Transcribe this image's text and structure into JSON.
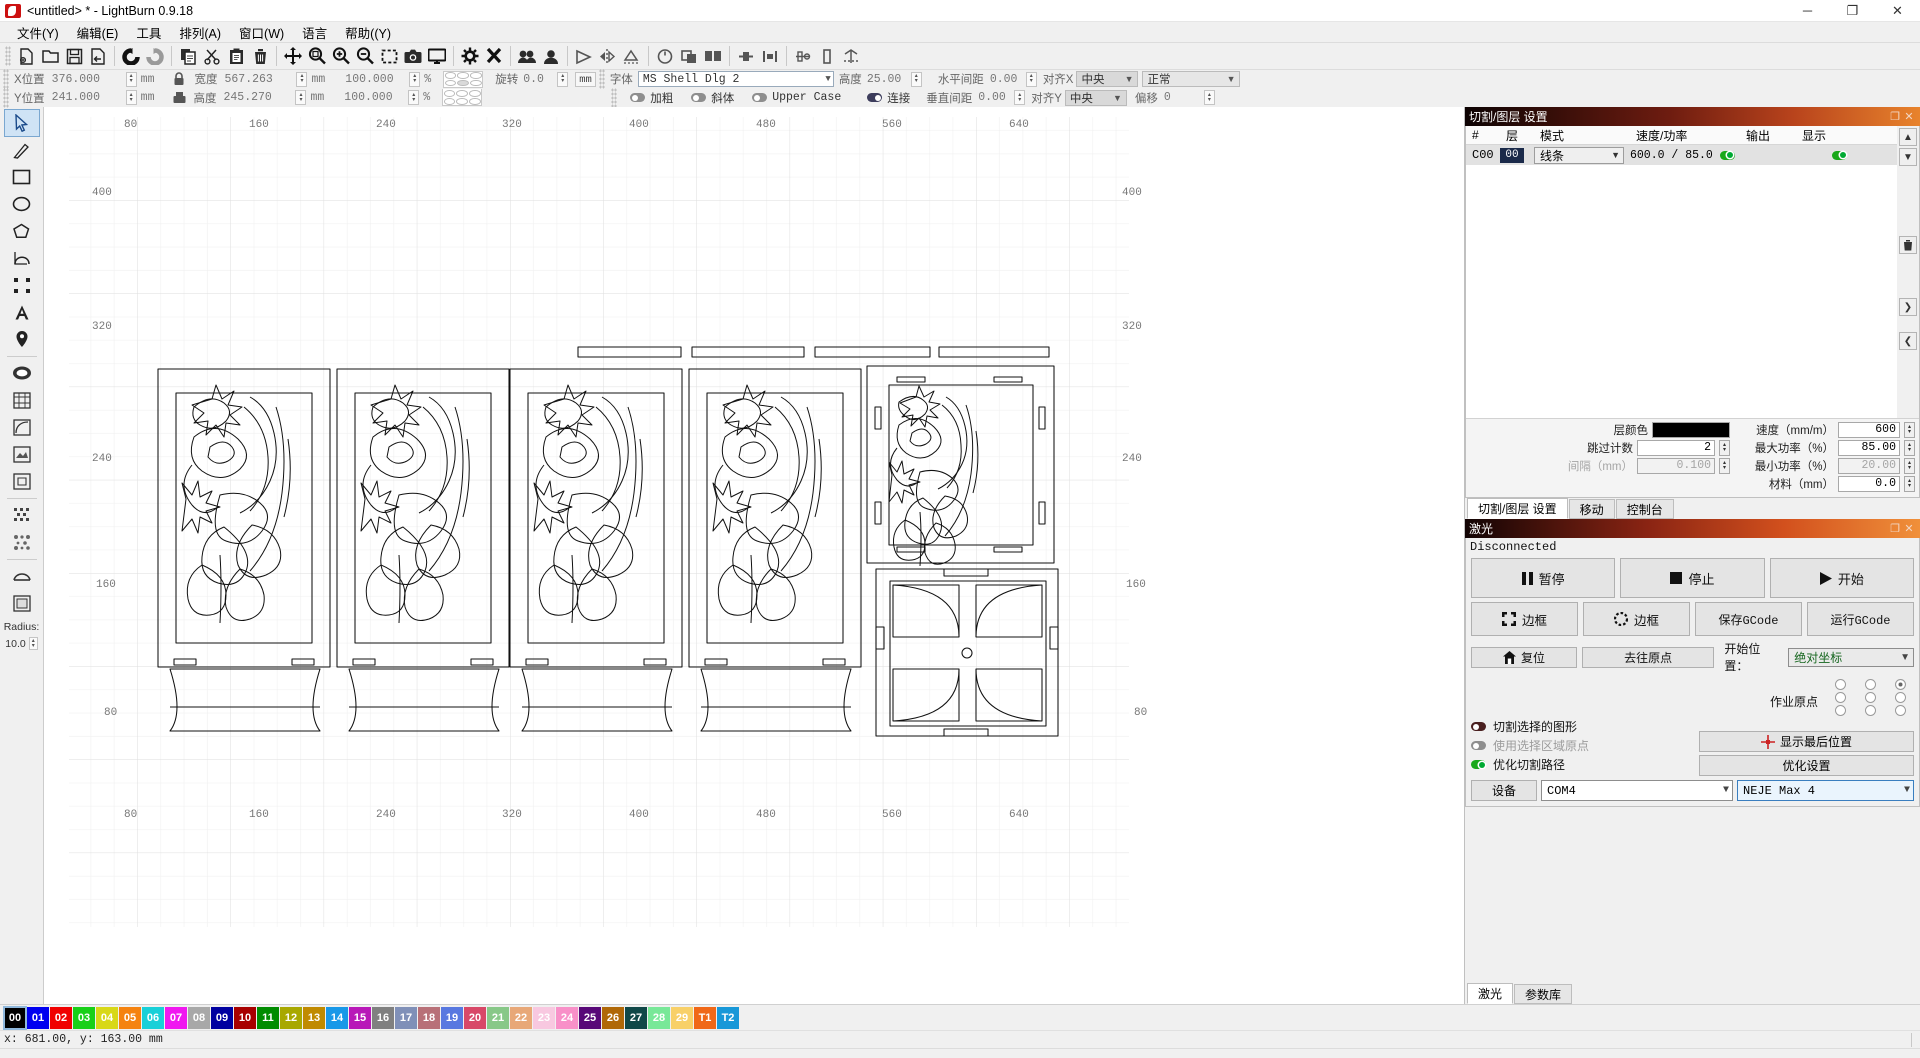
{
  "window": {
    "title": "<untitled> * - LightBurn 0.9.18",
    "minimize": "─",
    "maximize": "❐",
    "close": "✕"
  },
  "menubar": {
    "items": [
      {
        "label": "文件(Y)",
        "name": "menu-file"
      },
      {
        "label": "编辑(E)",
        "name": "menu-edit"
      },
      {
        "label": "工具",
        "name": "menu-tools"
      },
      {
        "label": "排列(A)",
        "name": "menu-arrange"
      },
      {
        "label": "窗口(W)",
        "name": "menu-window"
      },
      {
        "label": "语言",
        "name": "menu-language"
      },
      {
        "label": "帮助((Y)",
        "name": "menu-help"
      }
    ]
  },
  "toolbar": {
    "icons": [
      "new-file-icon",
      "open-folder-icon",
      "save-icon",
      "export-icon",
      "undo-icon",
      "redo-icon",
      "copy-icon",
      "cut-scissors-icon",
      "paste-icon",
      "delete-trash-icon",
      "move-icon",
      "zoom-fit-icon",
      "zoom-in-icon",
      "zoom-out-icon",
      "marquee-select-icon",
      "camera-icon",
      "monitor-icon",
      "settings-gear-icon",
      "device-settings-icon",
      "group-icon",
      "ungroup-icon",
      "flip-horizontal-icon",
      "mirror-horizontal-icon",
      "mirror-vertical-icon",
      "weld-icon",
      "boolean-union-icon",
      "boolean-subtract-icon",
      "boolean-intersect-icon",
      "offset-icon",
      "align-icon",
      "distribute-icon",
      "measure-icon"
    ]
  },
  "properties": {
    "row1": {
      "x_label": "X位置",
      "x_value": "376.000",
      "x_unit": "mm",
      "w_label": "宽度",
      "w_value": "567.263",
      "w_unit": "mm",
      "w_pct": "100.000",
      "pct_unit": "%"
    },
    "row2": {
      "y_label": "Y位置",
      "y_value": "241.000",
      "y_unit": "mm",
      "h_label": "高度",
      "h_value": "245.270",
      "h_unit": "mm",
      "h_pct": "100.000",
      "pct_unit": "%"
    },
    "rotate_label": "旋转",
    "rotate_value": "0.0",
    "rotate_unit": "mm",
    "font_label": "字体",
    "font_value": "MS Shell Dlg 2",
    "height_label": "高度",
    "height_value": "25.00",
    "hspace_label": "水平间距",
    "hspace_value": "0.00",
    "alignx_label": "对齐X",
    "alignx_value": "中央",
    "style_value": "正常",
    "bold_label": "加粗",
    "italic_label": "斜体",
    "upper_label": "Upper Case",
    "connect_label": "连接",
    "vspace_label": "垂直间距",
    "vspace_value": "0.00",
    "aligny_label": "对齐Y",
    "aligny_value": "中央",
    "offset_label": "偏移",
    "offset_value": "0"
  },
  "tools": {
    "items": [
      {
        "name": "select-arrow-tool",
        "selected": true
      },
      {
        "name": "draw-line-tool",
        "selected": false
      },
      {
        "name": "rectangle-tool",
        "selected": false
      },
      {
        "name": "ellipse-tool",
        "selected": false
      },
      {
        "name": "polygon-tool",
        "selected": false
      },
      {
        "name": "bezier-curve-tool",
        "selected": false
      },
      {
        "name": "edit-nodes-tool",
        "selected": false
      },
      {
        "name": "text-tool",
        "selected": false
      },
      {
        "name": "position-marker-tool",
        "selected": false
      },
      {
        "name": "offset-shapes-tool",
        "selected": false
      },
      {
        "name": "grid-array-tool",
        "selected": false
      },
      {
        "name": "circular-array-tool",
        "selected": false
      },
      {
        "name": "image-trace-tool",
        "selected": false
      },
      {
        "name": "print-cut-tool",
        "selected": false
      },
      {
        "name": "dither-tool",
        "selected": false
      },
      {
        "name": "dot-array-tool",
        "selected": false
      },
      {
        "name": "weld-shapes-tool",
        "selected": false
      },
      {
        "name": "picture-frame-tool",
        "selected": false
      }
    ],
    "radius_label": "Radius:",
    "radius_value": "10.0"
  },
  "canvas": {
    "ruler_top": [
      "80",
      "160",
      "240",
      "320",
      "400",
      "480",
      "560",
      "640"
    ],
    "ruler_bottom": [
      "80",
      "160",
      "240",
      "320",
      "400",
      "480",
      "560",
      "640"
    ],
    "ruler_left": [
      "400",
      "320",
      "240",
      "160",
      "80"
    ],
    "ruler_right": [
      "400",
      "320",
      "240",
      "160",
      "80"
    ]
  },
  "cut_panel": {
    "title": "切割/图层 设置",
    "headers": [
      "#",
      "层",
      "模式",
      "速度/功率",
      "输出",
      "显示"
    ],
    "rows": [
      {
        "hash": "C00",
        "layer": "00",
        "layer_color": "#1b2a4a",
        "mode": "线条",
        "speed_power": "600.0 / 85.0",
        "output_on": true,
        "show_on": true
      }
    ],
    "params": {
      "layer_color_label": "层颜色",
      "layer_color_value": "#000000",
      "speed_label": "速度（mm/m）",
      "speed_value": "600",
      "passes_label": "跳过计数",
      "passes_value": "2",
      "maxpower_label": "最大功率（%）",
      "maxpower_value": "85.00",
      "interval_label": "间隔（mm）",
      "interval_value": "0.100",
      "minpower_label": "最小功率（%）",
      "minpower_value": "20.00",
      "material_label": "材料（mm）",
      "material_value": "0.0"
    },
    "tabs": [
      {
        "label": "切割/图层 设置",
        "active": true
      },
      {
        "label": "移动",
        "active": false
      },
      {
        "label": "控制台",
        "active": false
      }
    ]
  },
  "laser_panel": {
    "title": "激光",
    "status": "Disconnected",
    "pause_label": "暂停",
    "stop_label": "停止",
    "start_label": "开始",
    "frame_label": "边框",
    "frame2_label": "边框",
    "save_gcode_label": "保存GCode",
    "run_gcode_label": "运行GCode",
    "home_label": "复位",
    "goto_origin_label": "去往原点",
    "start_from_label": "开始位置：",
    "start_from_value": "绝对坐标",
    "job_origin_label": "作业原点",
    "job_origin_selected_index": 2,
    "cut_selected_label": "切割选择的图形",
    "use_selection_origin_label": "使用选择区域原点",
    "optimize_path_label": "优化切割路径",
    "show_last_position_label": "显示最后位置",
    "optimize_settings_label": "优化设置",
    "device_label": "设备",
    "port_value": "COM4",
    "machine_value": "NEJE Max 4",
    "tabs": [
      {
        "label": "激光",
        "active": true
      },
      {
        "label": "参数库",
        "active": false
      }
    ]
  },
  "palette": {
    "swatches": [
      {
        "label": "00",
        "color": "#000000",
        "selected": true
      },
      {
        "label": "01",
        "color": "#0000f0"
      },
      {
        "label": "02",
        "color": "#f00000"
      },
      {
        "label": "03",
        "color": "#18d018"
      },
      {
        "label": "04",
        "color": "#d8d818"
      },
      {
        "label": "05",
        "color": "#f58310"
      },
      {
        "label": "06",
        "color": "#18d0d8"
      },
      {
        "label": "07",
        "color": "#f018f0"
      },
      {
        "label": "08",
        "color": "#a8a8a8"
      },
      {
        "label": "09",
        "color": "#0000a0"
      },
      {
        "label": "10",
        "color": "#a80000"
      },
      {
        "label": "11",
        "color": "#008c00"
      },
      {
        "label": "12",
        "color": "#a8a800"
      },
      {
        "label": "13",
        "color": "#c08a00"
      },
      {
        "label": "14",
        "color": "#1898e8"
      },
      {
        "label": "15",
        "color": "#b818b8"
      },
      {
        "label": "16",
        "color": "#808080"
      },
      {
        "label": "17",
        "color": "#8090b8"
      },
      {
        "label": "18",
        "color": "#b87078"
      },
      {
        "label": "19",
        "color": "#5878e0"
      },
      {
        "label": "20",
        "color": "#d84868"
      },
      {
        "label": "21",
        "color": "#88c888"
      },
      {
        "label": "22",
        "color": "#e8a878"
      },
      {
        "label": "23",
        "color": "#f8c8e0"
      },
      {
        "label": "24",
        "color": "#f890c8"
      },
      {
        "label": "25",
        "color": "#580878"
      },
      {
        "label": "26",
        "color": "#b06808"
      },
      {
        "label": "27",
        "color": "#104848"
      },
      {
        "label": "28",
        "color": "#78e898"
      },
      {
        "label": "29",
        "color": "#f8d068"
      },
      {
        "label": "T1",
        "color": "#f06818"
      },
      {
        "label": "T2",
        "color": "#1898d8"
      }
    ]
  },
  "statusbar": {
    "coords": "x: 681.00, y: 163.00 mm"
  }
}
